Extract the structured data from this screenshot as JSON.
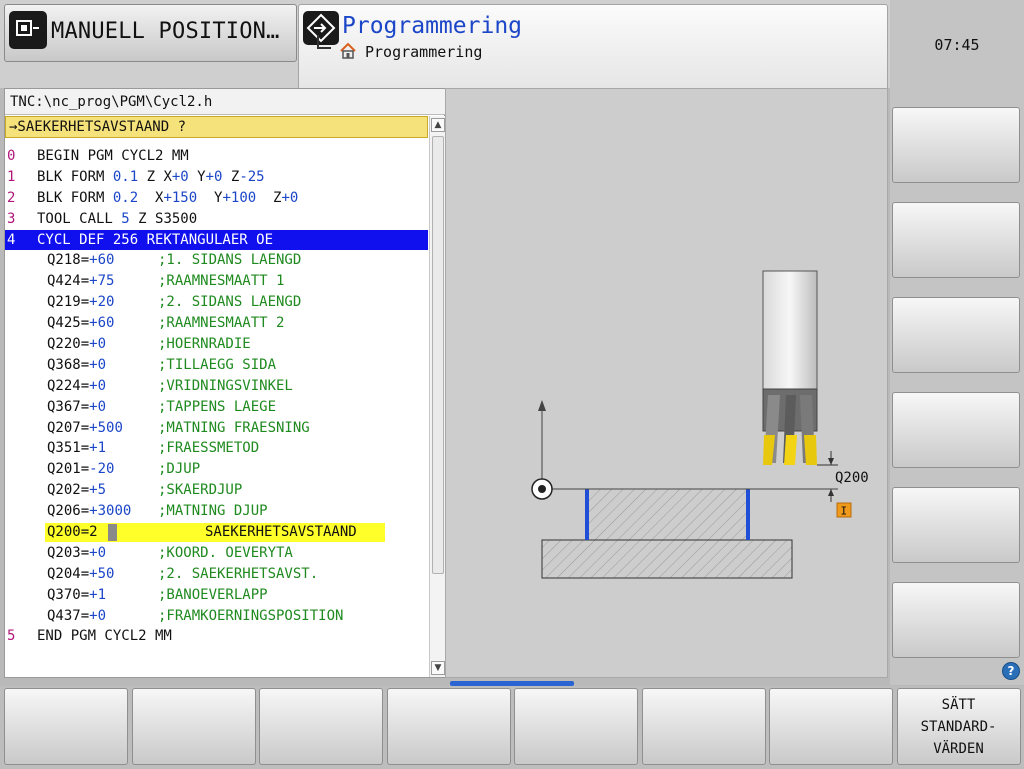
{
  "header": {
    "left_mode": "MANUELL POSITION…",
    "right_mode_title": "Programmering",
    "right_mode_subtitle": "Programmering"
  },
  "clock": "07:45",
  "program": {
    "path": "TNC:\\nc_prog\\PGM\\Cycl2.h",
    "dialog": "→SAEKERHETSAVSTAAND ?",
    "lines": [
      {
        "num": "0",
        "parts": [
          {
            "t": "BEGIN PGM CYCL2 MM"
          }
        ]
      },
      {
        "num": "1",
        "parts": [
          {
            "t": "BLK FORM "
          },
          {
            "t": "0.1",
            "b": 1
          },
          {
            "t": " Z X"
          },
          {
            "t": "+0",
            "b": 1
          },
          {
            "t": " Y"
          },
          {
            "t": "+0",
            "b": 1
          },
          {
            "t": " Z"
          },
          {
            "t": "-25",
            "b": 1
          }
        ]
      },
      {
        "num": "2",
        "parts": [
          {
            "t": "BLK FORM "
          },
          {
            "t": "0.2",
            "b": 1
          },
          {
            "t": "  X"
          },
          {
            "t": "+150",
            "b": 1
          },
          {
            "t": "  Y"
          },
          {
            "t": "+100",
            "b": 1
          },
          {
            "t": "  Z"
          },
          {
            "t": "+0",
            "b": 1
          }
        ]
      },
      {
        "num": "3",
        "parts": [
          {
            "t": "TOOL CALL "
          },
          {
            "t": "5",
            "b": 1
          },
          {
            "t": " Z S3500"
          }
        ]
      },
      {
        "num": "4",
        "parts": [
          {
            "t": "CYCL DEF 256 REKTANGULAER OE"
          }
        ],
        "selected": true
      }
    ],
    "params": [
      {
        "name": "Q218=",
        "value": "+60",
        "comment": ";1. SIDANS LAENGD"
      },
      {
        "name": "Q424=",
        "value": "+75",
        "comment": ";RAAMNESMAATT 1"
      },
      {
        "name": "Q219=",
        "value": "+20",
        "comment": ";2. SIDANS LAENGD"
      },
      {
        "name": "Q425=",
        "value": "+60",
        "comment": ";RAAMNESMAATT 2"
      },
      {
        "name": "Q220=",
        "value": "+0",
        "comment": ";HOERNRADIE"
      },
      {
        "name": "Q368=",
        "value": "+0",
        "comment": ";TILLAEGG SIDA"
      },
      {
        "name": "Q224=",
        "value": "+0",
        "comment": ";VRIDNINGSVINKEL"
      },
      {
        "name": "Q367=",
        "value": "+0",
        "comment": ";TAPPENS LAEGE"
      },
      {
        "name": "Q207=",
        "value": "+500",
        "comment": ";MATNING FRAESNING"
      },
      {
        "name": "Q351=",
        "value": "+1",
        "comment": ";FRAESSMETOD"
      },
      {
        "name": "Q201=",
        "value": "-20",
        "comment": ";DJUP"
      },
      {
        "name": "Q202=",
        "value": "+5",
        "comment": ";SKAERDJUP"
      },
      {
        "name": "Q206=",
        "value": "+3000",
        "comment": ";MATNING DJUP"
      }
    ],
    "edit_line": {
      "text": "Q200=2",
      "comment": "SAEKERHETSAVSTAAND"
    },
    "params_after": [
      {
        "name": "Q203=",
        "value": "+0",
        "comment": ";KOORD. OEVERYTA"
      },
      {
        "name": "Q204=",
        "value": "+50",
        "comment": ";2. SAEKERHETSAVST."
      },
      {
        "name": "Q370=",
        "value": "+1",
        "comment": ";BANOEVERLAPP"
      },
      {
        "name": "Q437=",
        "value": "+0",
        "comment": ";FRAMKOERNINGSPOSITION"
      }
    ],
    "end_line": {
      "num": "5",
      "text": "END PGM CYCL2 MM"
    }
  },
  "graphic": {
    "q_label": "Q200",
    "marker": "I"
  },
  "softkeys": [
    "",
    "",
    "",
    "",
    "",
    "",
    "",
    "SÄTT\nSTANDARD-\nVÄRDEN"
  ],
  "help_glyph": "?",
  "scroll_up_glyph": "▲",
  "scroll_down_glyph": "▼"
}
